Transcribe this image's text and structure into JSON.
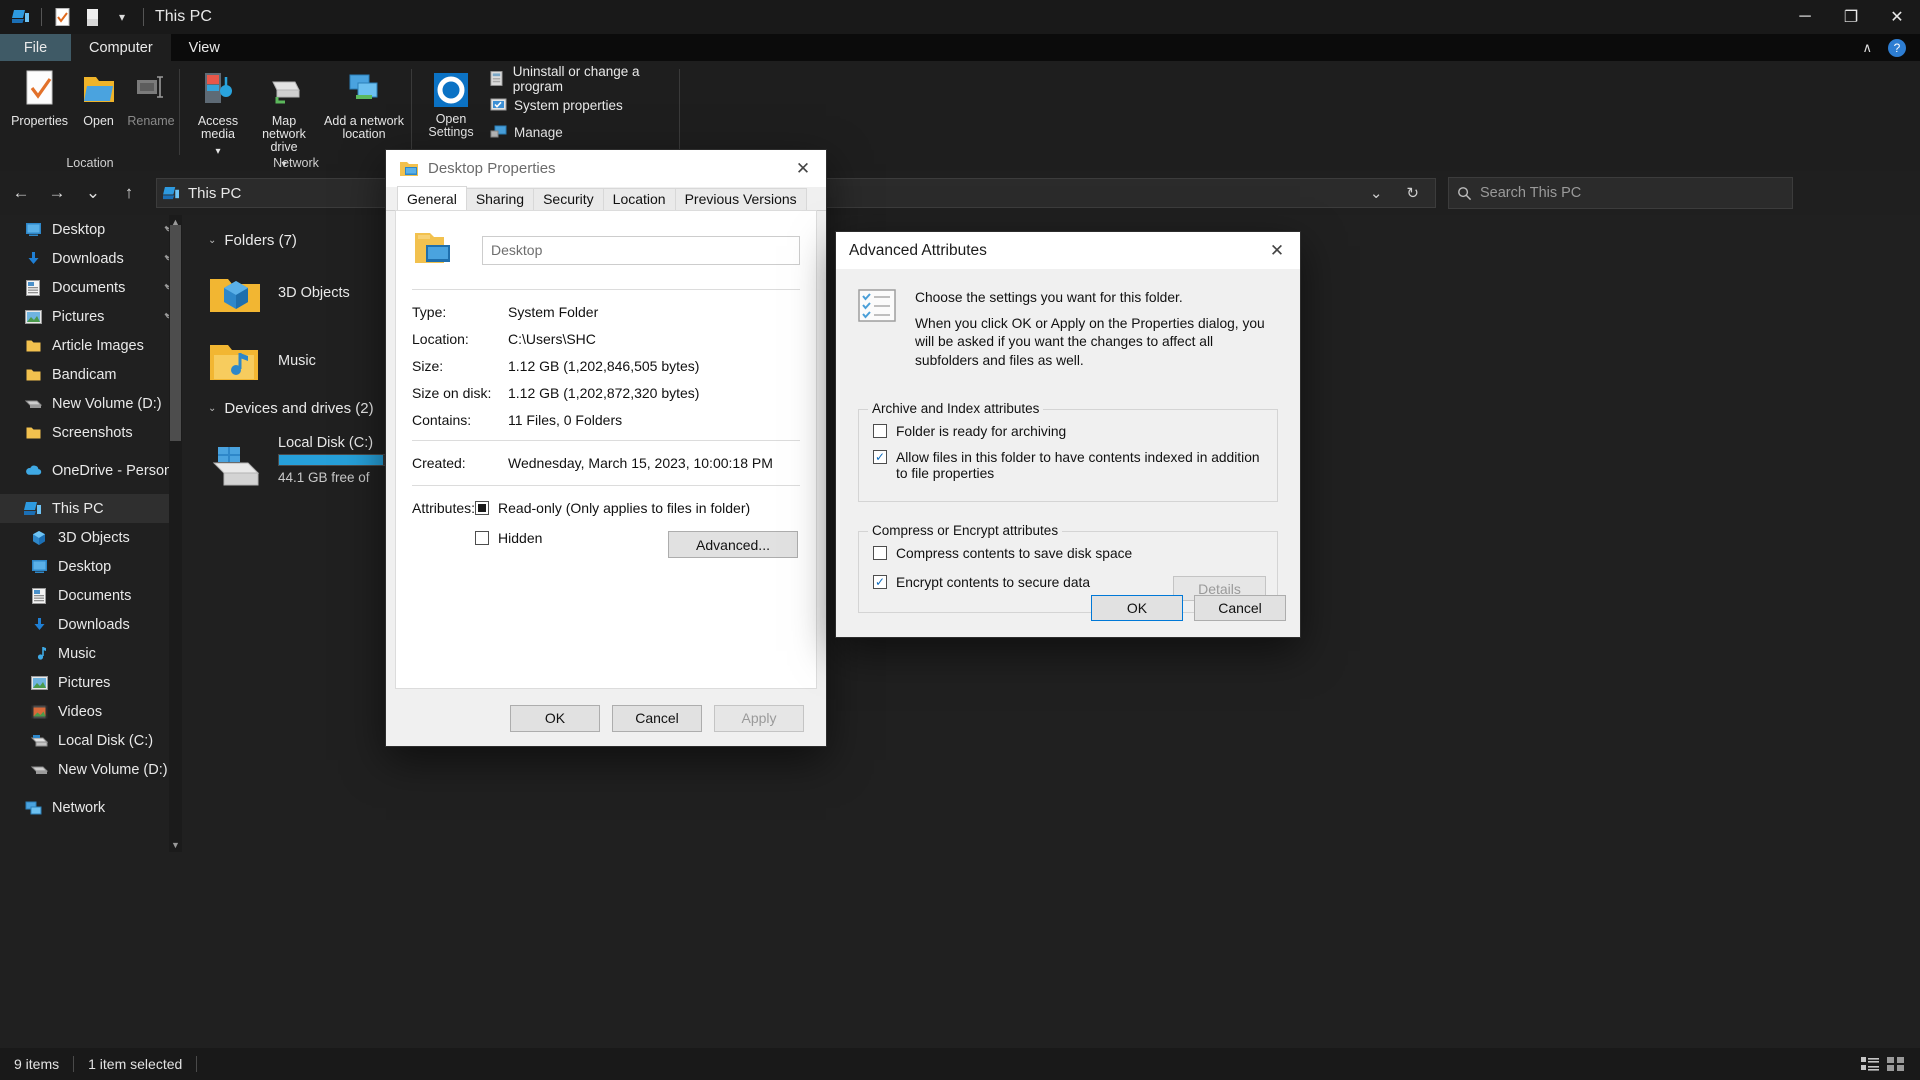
{
  "window": {
    "title": "This PC",
    "quick_access_icons": [
      "this-pc-icon",
      "properties-icon",
      "folder-icon"
    ],
    "dropdown_glyph": "▾",
    "minimize": "─",
    "restore": "❐",
    "close": "✕"
  },
  "ribbon": {
    "tabs": [
      {
        "label": "File",
        "type": "file"
      },
      {
        "label": "Computer",
        "type": "active"
      },
      {
        "label": "View",
        "type": "normal"
      }
    ],
    "collapse_glyph": "∧",
    "help_glyph": "?",
    "groups": [
      {
        "name": "Location",
        "label": "Location",
        "buttons": [
          {
            "label": "Properties",
            "icon": "properties-icon",
            "enabled": true
          },
          {
            "label": "Open",
            "icon": "open-folder-icon",
            "enabled": true
          },
          {
            "label": "Rename",
            "icon": "rename-icon",
            "enabled": false
          }
        ]
      },
      {
        "name": "Network",
        "label": "Network",
        "buttons": [
          {
            "label": "Access media",
            "icon": "access-media-icon",
            "dropdown": true
          },
          {
            "label": "Map network drive",
            "icon": "map-network-drive-icon",
            "dropdown": true
          },
          {
            "label": "Add a network location",
            "icon": "add-network-location-icon",
            "dropdown": false
          }
        ]
      },
      {
        "name": "System",
        "label": "",
        "big": {
          "label": "Open Settings",
          "icon": "settings-gear-icon"
        },
        "small": [
          {
            "label": "Uninstall or change a program",
            "icon": "uninstall-program-icon"
          },
          {
            "label": "System properties",
            "icon": "system-properties-icon"
          },
          {
            "label": "Manage",
            "icon": "manage-icon"
          }
        ]
      }
    ]
  },
  "addressbar": {
    "back": "←",
    "forward": "→",
    "recent": "⌄",
    "up": "↑",
    "crumb_icon": "this-pc-icon",
    "crumb": "This PC",
    "dropdown": "⌄",
    "refresh": "↻",
    "search_placeholder": "Search This PC",
    "search_icon": "search-icon"
  },
  "sidebar": {
    "items": [
      {
        "label": "Desktop",
        "icon": "desktop-icon",
        "pinned": true,
        "indent": 0
      },
      {
        "label": "Downloads",
        "icon": "download-icon",
        "pinned": true,
        "indent": 0
      },
      {
        "label": "Documents",
        "icon": "document-icon",
        "pinned": true,
        "indent": 0
      },
      {
        "label": "Pictures",
        "icon": "pictures-icon",
        "pinned": true,
        "indent": 0
      },
      {
        "label": "Article Images",
        "icon": "folder-icon",
        "pinned": false,
        "indent": 0
      },
      {
        "label": "Bandicam",
        "icon": "folder-icon",
        "pinned": false,
        "indent": 0
      },
      {
        "label": "New Volume (D:)",
        "icon": "drive-icon",
        "pinned": false,
        "indent": 0
      },
      {
        "label": "Screenshots",
        "icon": "folder-icon",
        "pinned": false,
        "indent": 0
      },
      {
        "label": "",
        "icon": "spacer",
        "pinned": false,
        "indent": 0
      },
      {
        "label": "OneDrive - Person",
        "icon": "onedrive-icon",
        "pinned": false,
        "indent": 0
      },
      {
        "label": "",
        "icon": "spacer",
        "pinned": false,
        "indent": 0
      },
      {
        "label": "This PC",
        "icon": "this-pc-icon",
        "pinned": false,
        "indent": 0,
        "selected": true
      },
      {
        "label": "3D Objects",
        "icon": "3d-objects-icon",
        "pinned": false,
        "indent": 1
      },
      {
        "label": "Desktop",
        "icon": "desktop-icon",
        "pinned": false,
        "indent": 1
      },
      {
        "label": "Documents",
        "icon": "document-icon",
        "pinned": false,
        "indent": 1
      },
      {
        "label": "Downloads",
        "icon": "download-icon",
        "pinned": false,
        "indent": 1
      },
      {
        "label": "Music",
        "icon": "music-icon",
        "pinned": false,
        "indent": 1
      },
      {
        "label": "Pictures",
        "icon": "pictures-icon",
        "pinned": false,
        "indent": 1
      },
      {
        "label": "Videos",
        "icon": "videos-icon",
        "pinned": false,
        "indent": 1
      },
      {
        "label": "Local Disk (C:)",
        "icon": "harddisk-icon",
        "pinned": false,
        "indent": 1
      },
      {
        "label": "New Volume (D:)",
        "icon": "drive-icon",
        "pinned": false,
        "indent": 1
      },
      {
        "label": "",
        "icon": "spacer",
        "pinned": false,
        "indent": 0
      },
      {
        "label": "Network",
        "icon": "network-icon",
        "pinned": false,
        "indent": 0
      }
    ]
  },
  "content": {
    "groups": [
      {
        "header": "Folders (7)",
        "expand_glyph": "⌄",
        "items": [
          {
            "label": "3D Objects",
            "icon": "3d-objects-icon"
          },
          {
            "label": "Music",
            "icon": "music-folder-icon"
          }
        ]
      },
      {
        "header": "Devices and drives (2)",
        "expand_glyph": "⌄",
        "items": [
          {
            "label": "Local Disk (C:)",
            "icon": "harddisk-icon",
            "free": "44.1 GB free of",
            "fill_percent": 62
          }
        ]
      }
    ]
  },
  "statusbar": {
    "item_count": "9 items",
    "selection": "1 item selected",
    "view_details_icon": "details-view-icon",
    "view_tiles_icon": "tiles-view-icon"
  },
  "properties_dialog": {
    "title": "Desktop Properties",
    "icon": "folder-desktop-icon",
    "close": "✕",
    "tabs": [
      {
        "label": "General",
        "active": true
      },
      {
        "label": "Sharing",
        "active": false
      },
      {
        "label": "Security",
        "active": false
      },
      {
        "label": "Location",
        "active": false
      },
      {
        "label": "Previous Versions",
        "active": false
      }
    ],
    "name_value": "Desktop",
    "fields": [
      {
        "key": "Type:",
        "value": "System Folder"
      },
      {
        "key": "Location:",
        "value": "C:\\Users\\SHC"
      },
      {
        "key": "Size:",
        "value": "1.12 GB (1,202,846,505 bytes)"
      },
      {
        "key": "Size on disk:",
        "value": "1.12 GB (1,202,872,320 bytes)"
      },
      {
        "key": "Contains:",
        "value": "11 Files, 0 Folders"
      }
    ],
    "created_key": "Created:",
    "created_value": "Wednesday, March 15, 2023, 10:00:18 PM",
    "attributes_key": "Attributes:",
    "attributes": [
      {
        "label": "Read-only (Only applies to files in folder)",
        "state": "indeterminate"
      },
      {
        "label": "Hidden",
        "state": "unchecked"
      }
    ],
    "advanced_button": "Advanced...",
    "buttons": [
      {
        "label": "OK",
        "state": "normal"
      },
      {
        "label": "Cancel",
        "state": "normal"
      },
      {
        "label": "Apply",
        "state": "disabled"
      }
    ]
  },
  "advanced_dialog": {
    "title": "Advanced Attributes",
    "close": "✕",
    "icon": "checklist-icon",
    "intro_line1": "Choose the settings you want for this folder.",
    "intro_line2": "When you click OK or Apply on the Properties dialog, you will be asked if you want the changes to affect all subfolders and files as well.",
    "groups": [
      {
        "legend": "Archive and Index attributes",
        "checkboxes": [
          {
            "label": "Folder is ready for archiving",
            "state": "unchecked"
          },
          {
            "label": "Allow files in this folder to have contents indexed in addition to file properties",
            "state": "checked"
          }
        ]
      },
      {
        "legend": "Compress or Encrypt attributes",
        "checkboxes": [
          {
            "label": "Compress contents to save disk space",
            "state": "unchecked"
          },
          {
            "label": "Encrypt contents to secure data",
            "state": "checked"
          }
        ],
        "details_button": {
          "label": "Details",
          "state": "disabled"
        }
      }
    ],
    "buttons": [
      {
        "label": "OK",
        "state": "primary"
      },
      {
        "label": "Cancel",
        "state": "normal"
      }
    ]
  },
  "colors": {
    "accent": "#0078d7",
    "drive_bar": "#26a0da",
    "file_tab": "#3f5a66",
    "selection": "#2f2f2f"
  }
}
